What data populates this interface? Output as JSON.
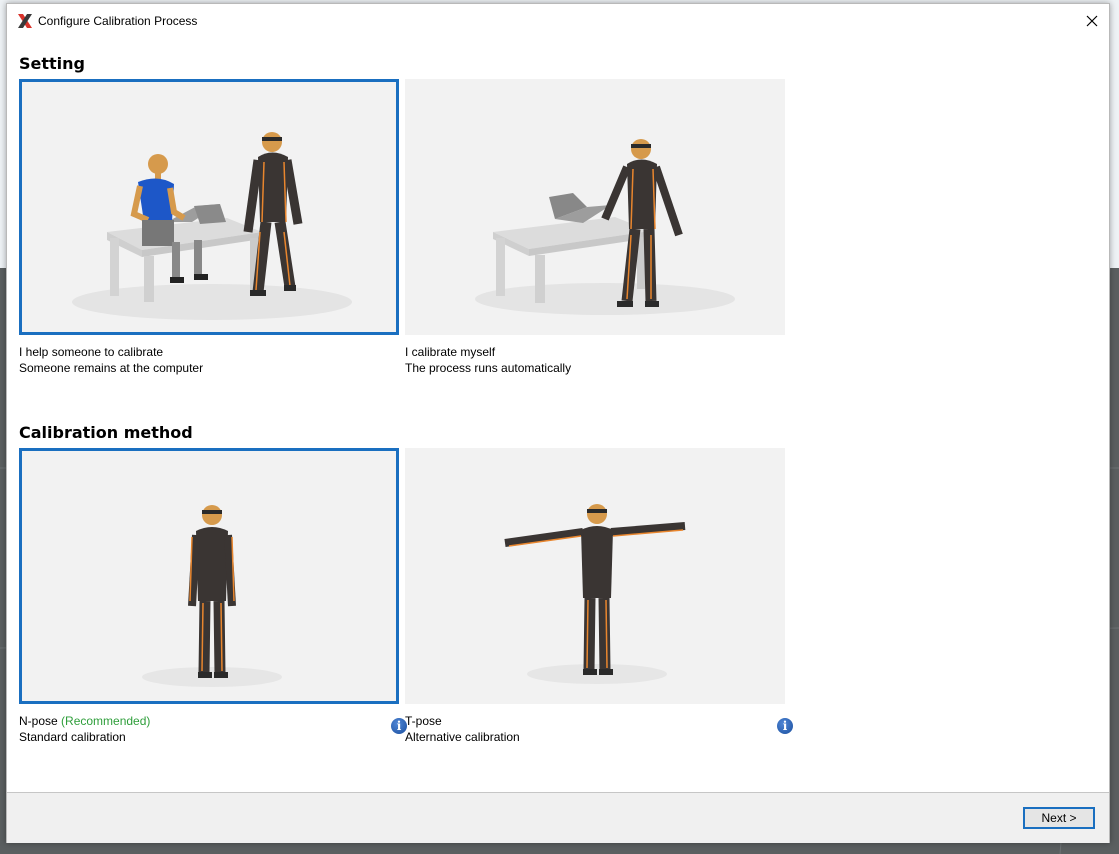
{
  "window": {
    "title": "Configure Calibration Process",
    "logo_icon": "xsens-x-logo",
    "close_icon": "close-icon"
  },
  "setting": {
    "heading": "Setting",
    "options": [
      {
        "title": "I help someone to calibrate",
        "subtitle": "Someone remains at the computer",
        "selected": true
      },
      {
        "title": "I calibrate myself",
        "subtitle": "The process runs automatically",
        "selected": false
      }
    ]
  },
  "method": {
    "heading": "Calibration method",
    "options": [
      {
        "title": "N-pose",
        "tag": "(Recommended)",
        "subtitle": "Standard calibration",
        "selected": true,
        "info_icon": "info-icon"
      },
      {
        "title": "T-pose",
        "tag": "",
        "subtitle": "Alternative calibration",
        "selected": false,
        "info_icon": "info-icon"
      }
    ]
  },
  "footer": {
    "next_label": "Next >"
  },
  "colors": {
    "accent": "#1a6fc0",
    "recommended": "#2e9e3a",
    "suit": "#3a3533",
    "stripe": "#e9862e",
    "skin": "#d69a4c"
  },
  "info_glyph": "i"
}
